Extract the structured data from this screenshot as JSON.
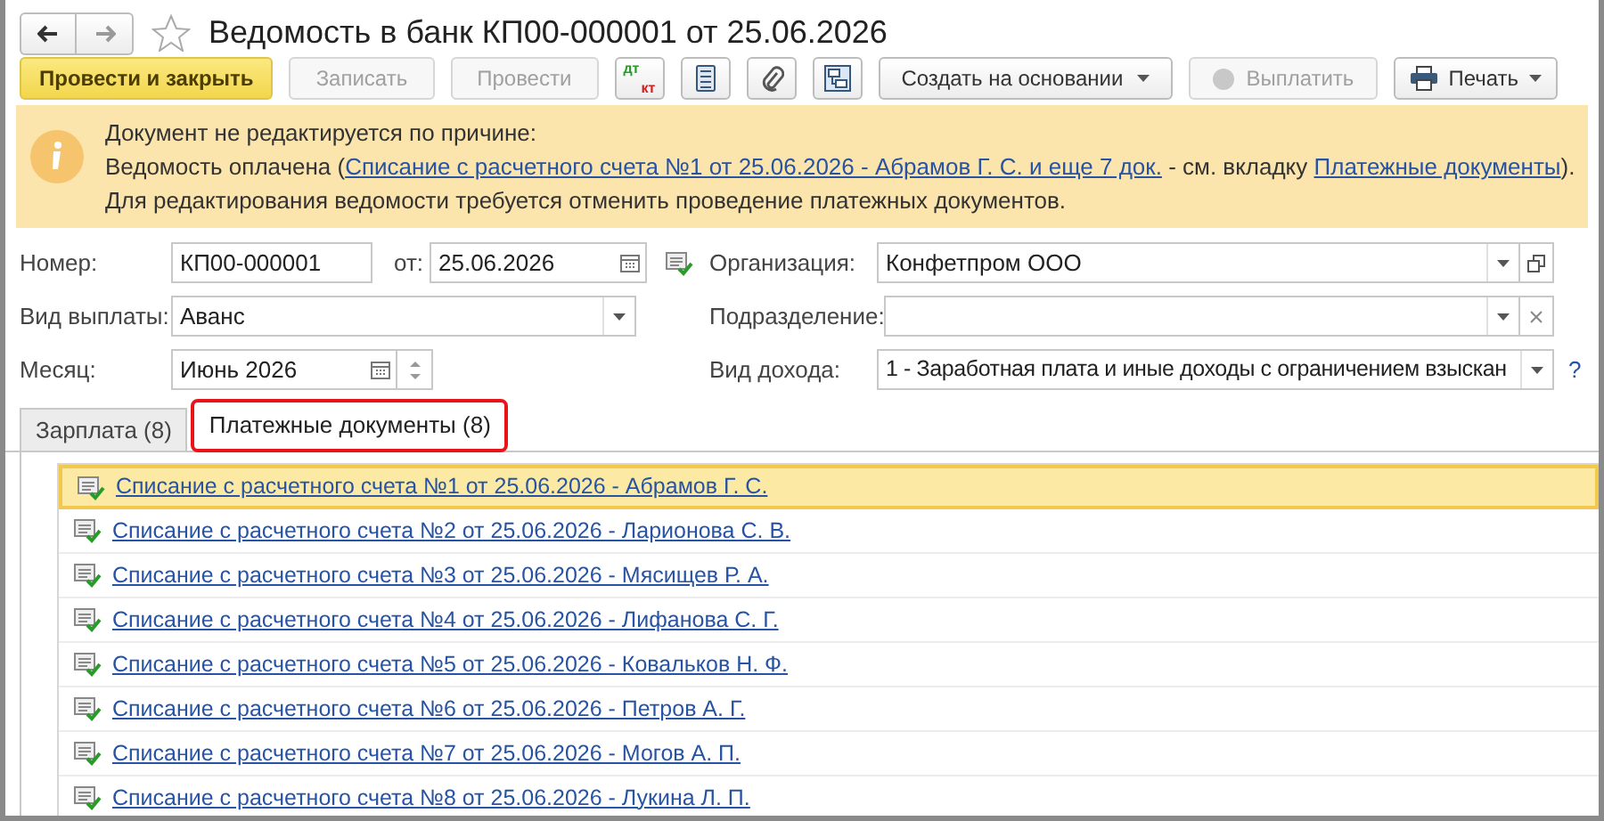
{
  "window": {
    "title": "Ведомость в банк КП00-000001 от 25.06.2026",
    "favorite": false
  },
  "toolbar": [
    {
      "kind": "default",
      "label": "Провести и закрыть",
      "disabled": false
    },
    {
      "kind": "text",
      "label": "Записать",
      "disabled": true
    },
    {
      "kind": "text",
      "label": "Провести",
      "disabled": true
    },
    {
      "kind": "dtkt",
      "labels": [
        "дт",
        "кт"
      ]
    },
    {
      "kind": "list"
    },
    {
      "kind": "clip"
    },
    {
      "kind": "structure"
    },
    {
      "kind": "menu",
      "label": "Создать на основании",
      "disabled": false
    },
    {
      "kind": "coin",
      "label": "Выплатить",
      "disabled": true
    },
    {
      "kind": "print",
      "label": "Печать",
      "disabled": false
    }
  ],
  "info": {
    "heading": "Документ не редактируется по причине:",
    "line": [
      {
        "kind": "text",
        "text": "Ведомость оплачена ("
      },
      {
        "kind": "link",
        "text": "Списание с расчетного счета №1 от 25.06.2026 - Абрамов Г. С. и еще 7 док."
      },
      {
        "kind": "text",
        "text": " - см. вкладку "
      },
      {
        "kind": "link",
        "text": "Платежные документы"
      },
      {
        "kind": "text",
        "text": ")."
      }
    ],
    "footer": "Для редактирования ведомости требуется отменить проведение платежных документов."
  },
  "form": {
    "number": {
      "label": "Номер:",
      "value": "КП00-000001"
    },
    "date": {
      "label": "от:",
      "value": "25.06.2026"
    },
    "organization": {
      "label": "Организация:",
      "value": "Конфетпром ООО"
    },
    "payment_type": {
      "label": "Вид выплаты:",
      "value": "Аванс"
    },
    "department": {
      "label": "Подразделение:"
    },
    "month": {
      "label": "Месяц:",
      "value": "Июнь 2026"
    },
    "income_type": {
      "label": "Вид дохода:",
      "value": "1 - Заработная плата и иные доходы с ограничением взыскан"
    },
    "help": "?"
  },
  "tabs": [
    {
      "label": "Зарплата (8)",
      "selected": false,
      "highlighted": false
    },
    {
      "label": "Платежные документы (8)",
      "selected": true,
      "highlighted": true
    }
  ],
  "documents": [
    {
      "text": "Списание с расчетного счета №1 от 25.06.2026 - Абрамов Г. С.",
      "selected": true
    },
    {
      "text": "Списание с расчетного счета №2 от 25.06.2026 - Ларионова С. В.",
      "selected": false
    },
    {
      "text": "Списание с расчетного счета №3 от 25.06.2026 - Мясищев Р. А.",
      "selected": false
    },
    {
      "text": "Списание с расчетного счета №4 от 25.06.2026 - Лифанова С. Г.",
      "selected": false
    },
    {
      "text": "Списание с расчетного счета №5 от 25.06.2026 - Ковальков Н. Ф.",
      "selected": false
    },
    {
      "text": "Списание с расчетного счета №6 от 25.06.2026 - Петров А. Г.",
      "selected": false
    },
    {
      "text": "Списание с расчетного счета №7 от 25.06.2026 - Могов А. П.",
      "selected": false
    },
    {
      "text": "Списание с расчетного счета №8 от 25.06.2026 - Лукина Л. П.",
      "selected": false
    }
  ]
}
